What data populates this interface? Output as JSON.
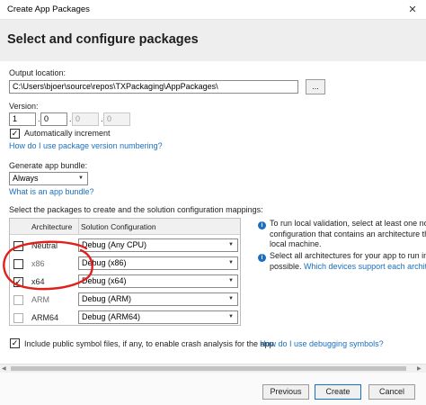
{
  "window": {
    "title": "Create App Packages",
    "close_glyph": "✕"
  },
  "header": {
    "title": "Select and configure packages"
  },
  "output": {
    "label": "Output location:",
    "value": "C:\\Users\\bjoer\\source\\repos\\TXPackaging\\AppPackages\\",
    "browse_label": "..."
  },
  "version": {
    "label": "Version:",
    "parts": [
      "1",
      "0",
      "0",
      "0"
    ],
    "auto_increment_label": "Automatically increment",
    "auto_increment_checked": true,
    "help_link": "How do I use package version numbering?"
  },
  "bundle": {
    "label": "Generate app bundle:",
    "selected": "Always",
    "help_link": "What is an app bundle?"
  },
  "packages": {
    "label": "Select the packages to create and the solution configuration mappings:",
    "headers": {
      "architecture": "Architecture",
      "configuration": "Solution Configuration"
    },
    "rows": [
      {
        "arch": "Neutral",
        "config": "Debug (Any CPU)",
        "checked": false
      },
      {
        "arch": "x86",
        "config": "Debug (x86)",
        "checked": false
      },
      {
        "arch": "x64",
        "config": "Debug (x64)",
        "checked": true
      },
      {
        "arch": "ARM",
        "config": "Debug (ARM)",
        "checked": false
      },
      {
        "arch": "ARM64",
        "config": "Debug (ARM64)",
        "checked": false
      }
    ]
  },
  "info": {
    "item1": [
      "To run local validation, select at least one non-",
      "configuration that contains an architecture tha",
      "local machine."
    ],
    "item2_lines": [
      "Select all architectures for your app to run in",
      "possible."
    ],
    "item2_link": "Which devices support each architect"
  },
  "symbols": {
    "label": "Include public symbol files, if any, to enable crash analysis for the app.",
    "link": "How do I use debugging symbols?",
    "checked": true
  },
  "footer": {
    "previous": "Previous",
    "create": "Create",
    "cancel": "Cancel"
  },
  "colors": {
    "link": "#1a6fc2",
    "annotation": "#e0201a"
  }
}
